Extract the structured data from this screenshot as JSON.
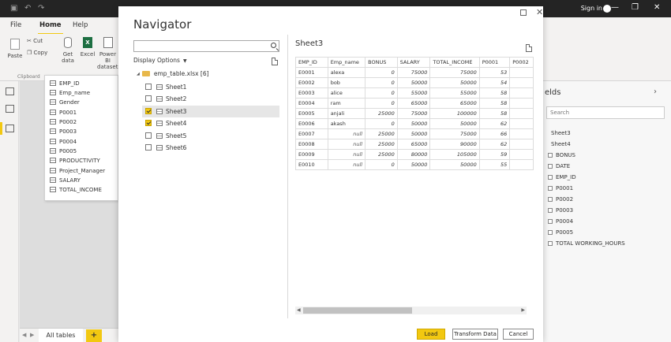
{
  "app": {
    "sign_in": "Sign in",
    "tabs": [
      "File",
      "Home",
      "Help"
    ],
    "ribbon": {
      "paste": "Paste",
      "cut": "Cut",
      "copy": "Copy",
      "get_data": "Get data",
      "excel": "Excel",
      "power_bi_datasets": "Power BI datasets",
      "clipboard_group": "Clipboard"
    },
    "bottom_tab": "All tables",
    "add_tab": "+"
  },
  "field_popup": {
    "items": [
      "EMP_ID",
      "Emp_name",
      "Gender",
      "P0001",
      "P0002",
      "P0003",
      "P0004",
      "P0005",
      "PRODUCTIVITY",
      "Project_Manager",
      "SALARY",
      "TOTAL_INCOME"
    ]
  },
  "fields_panel": {
    "title": "elds",
    "search_placeholder": "Search",
    "tables": [
      "Sheet3",
      "Sheet4"
    ],
    "fields": [
      "BONUS",
      "DATE",
      "EMP_ID",
      "P0001",
      "P0002",
      "P0003",
      "P0004",
      "P0005",
      "TOTAL WORKING_HOURS"
    ]
  },
  "navigator": {
    "title": "Navigator",
    "search_value": "",
    "display_options": "Display Options",
    "file_node": "emp_table.xlsx [6]",
    "sheets": [
      {
        "name": "Sheet1",
        "checked": false
      },
      {
        "name": "Sheet2",
        "checked": false
      },
      {
        "name": "Sheet3",
        "checked": true
      },
      {
        "name": "Sheet4",
        "checked": true
      },
      {
        "name": "Sheet5",
        "checked": false
      },
      {
        "name": "Sheet6",
        "checked": false
      }
    ],
    "preview_title": "Sheet3",
    "columns": [
      "EMP_ID",
      "Emp_name",
      "BONUS",
      "SALARY",
      "TOTAL_INCOME",
      "P0001",
      "P0002"
    ],
    "rows": [
      [
        "E0001",
        "alexa",
        "0",
        "75000",
        "75000",
        "53"
      ],
      [
        "E0002",
        "bob",
        "0",
        "50000",
        "50000",
        "54"
      ],
      [
        "E0003",
        "alice",
        "0",
        "55000",
        "55000",
        "58"
      ],
      [
        "E0004",
        "ram",
        "0",
        "65000",
        "65000",
        "58"
      ],
      [
        "E0005",
        "anjali",
        "25000",
        "75000",
        "100000",
        "58"
      ],
      [
        "E0006",
        "akash",
        "0",
        "50000",
        "50000",
        "62"
      ],
      [
        "E0007",
        "null",
        "25000",
        "50000",
        "75000",
        "66"
      ],
      [
        "E0008",
        "null",
        "25000",
        "65000",
        "90000",
        "62"
      ],
      [
        "E0009",
        "null",
        "25000",
        "80000",
        "105000",
        "59"
      ],
      [
        "E0010",
        "null",
        "0",
        "50000",
        "50000",
        "55"
      ]
    ],
    "buttons": {
      "load": "Load",
      "transform": "Transform Data",
      "cancel": "Cancel"
    }
  }
}
